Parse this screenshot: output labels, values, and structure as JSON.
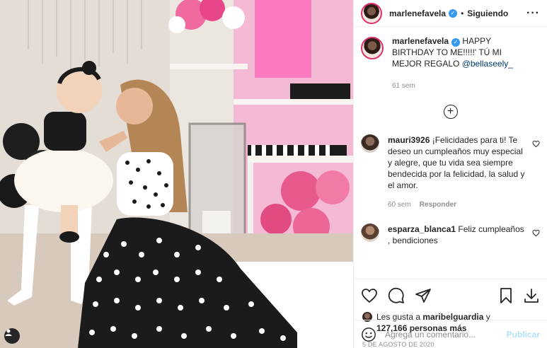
{
  "post": {
    "author": {
      "username": "marlenefavela",
      "verified": true,
      "follow_state": "Siguiendo",
      "separator": "•"
    },
    "caption": {
      "username": "marlenefavela",
      "text": " HAPPY BIRTHDAY TO ME!!!!!' TÚ MI MEJOR REGALO ",
      "mention": "@bellaseely_",
      "age": "61 sem"
    },
    "load_more_icon": "plus-circle-icon",
    "comments": [
      {
        "username": "mauri3926",
        "text": " ¡Felicidades para ti! Te deseo un cumpleaños muy especial y alegre, que tu vida sea siempre bendecida por la felicidad, la salud y el amor.",
        "age": "60 sem",
        "reply_label": "Responder"
      },
      {
        "username": "esparza_blanca1",
        "text": " Feliz cumpleaños , bendiciones"
      }
    ],
    "likes": {
      "prefix": "Les gusta a ",
      "first_user": "maribelguardia",
      "connector": " y",
      "count_text": "127,166 personas más"
    },
    "date": "5 DE AGOSTO DE 2020",
    "add_comment": {
      "placeholder": "Agrega un comentario...",
      "publish_label": "Publicar"
    },
    "icons": {
      "like": "heart-icon",
      "comment": "comment-icon",
      "share": "share-icon",
      "save": "bookmark-icon",
      "download": "download-icon",
      "emoji": "emoji-icon",
      "tag": "user-tag-icon",
      "more": "more-options-icon"
    },
    "colors": {
      "verified": "#3897f0",
      "story_ring": "#e1306c",
      "publish_disabled": "#b2dffc",
      "secondary_text": "#8e8e8e"
    }
  }
}
